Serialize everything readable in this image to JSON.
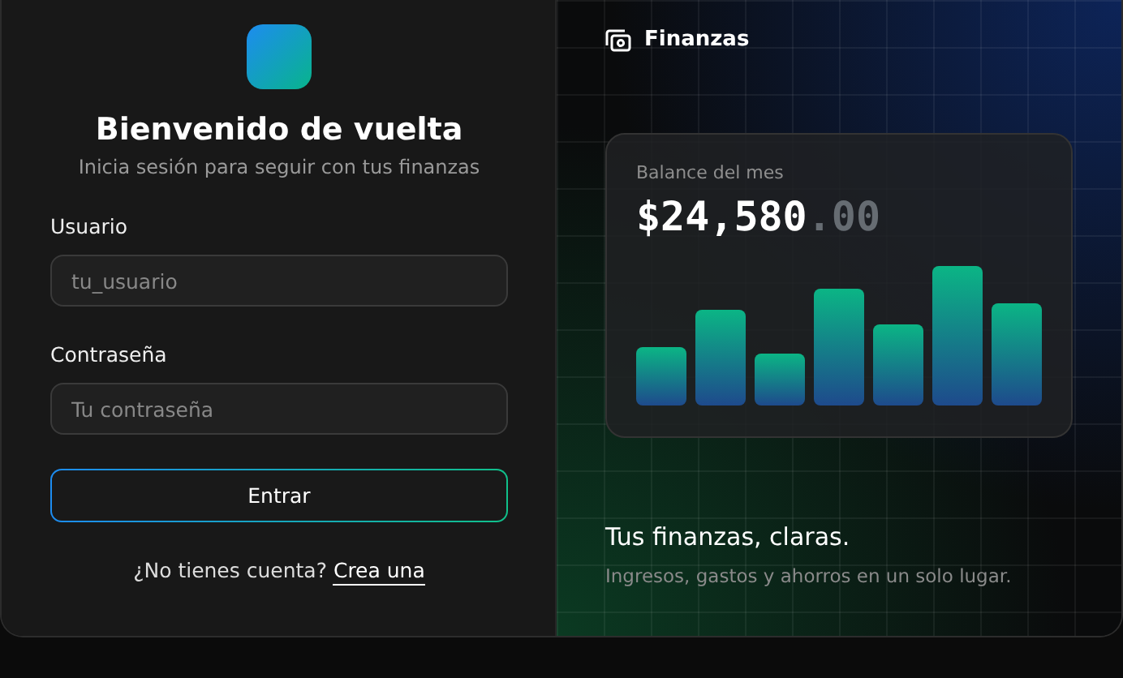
{
  "login": {
    "title": "Bienvenido de vuelta",
    "subtitle": "Inicia sesión para seguir con tus finanzas",
    "fields": [
      {
        "label": "Usuario",
        "placeholder": "tu_usuario"
      },
      {
        "label": "Contraseña",
        "placeholder": "Tu contraseña"
      }
    ],
    "button": "Entrar",
    "footer_text": "¿No tienes cuenta?",
    "footer_link": "Crea una"
  },
  "showcase": {
    "brand": "Finanzas",
    "card_label": "Balance del mes",
    "amount": "$24,580",
    "amount_cents": ".00",
    "tagline": "Tus finanzas, claras.",
    "description": "Ingresos, gastos y ahorros en un solo lugar."
  }
}
